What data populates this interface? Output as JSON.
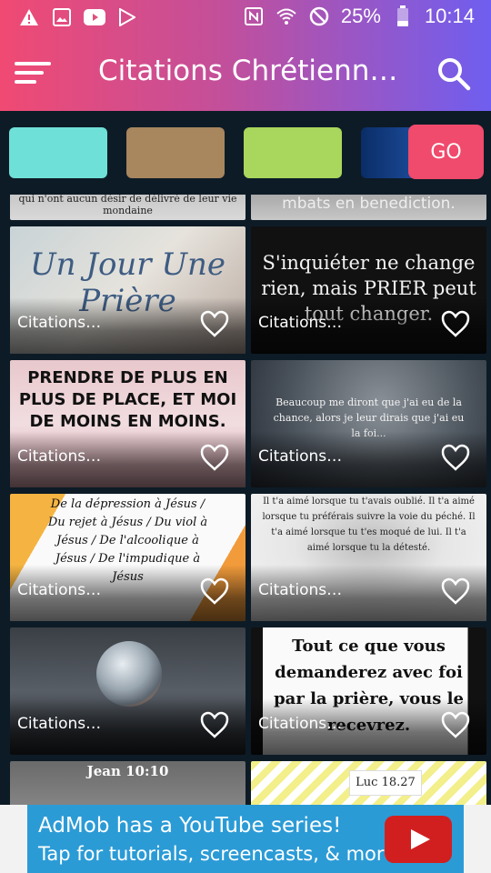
{
  "status_bar": {
    "battery": "25%",
    "time": "10:14"
  },
  "toolbar": {
    "title": "Citations Chrétienne…"
  },
  "color_strip": {
    "go_label": "GO",
    "colors": [
      "#6fe0d8",
      "#a8865e",
      "#a9d65c",
      "#1e4fa0"
    ]
  },
  "cards": [
    {
      "label": "",
      "text": "qui n'ont aucun désir de délivré de leur vie mondaine"
    },
    {
      "label": "",
      "text": "mbats en benediction."
    },
    {
      "label": "Citations…",
      "text": "Un Jour Une Prière"
    },
    {
      "label": "Citations…",
      "text": "S'inquiéter ne change rien, mais PRIER peut tout changer."
    },
    {
      "label": "Citations…",
      "text": "PRENDRE DE PLUS EN PLUS DE PLACE, ET MOI DE MOINS EN MOINS."
    },
    {
      "label": "Citations…",
      "text": "Beaucoup me diront que j'ai eu de la chance, alors je leur dirais que j'ai eu la foi..."
    },
    {
      "label": "Citations…",
      "text": "De la dépression à Jésus / Du rejet à Jésus / Du viol à Jésus / De l'alcoolique à Jésus / De l'impudique à Jésus"
    },
    {
      "label": "Citations…",
      "text": "Il t'a aimé lorsque tu t'avais oublié. Il t'a aimé lorsque tu préférais suivre la voie du péché. Il t'a aimé lorsque tu t'es moqué de lui. Il t'a aimé lorsque tu la détesté."
    },
    {
      "label": "Citations…",
      "text": ""
    },
    {
      "label": "Citations…",
      "text": "Tout ce que vous demanderez avec foi par la prière, vous le recevrez."
    },
    {
      "label": "",
      "text": "Jean 10:10"
    },
    {
      "label": "",
      "text": "Luc 18.27"
    }
  ],
  "ad": {
    "line1": "AdMob has a YouTube series!",
    "line2": "Tap for tutorials, screencasts, & more."
  }
}
